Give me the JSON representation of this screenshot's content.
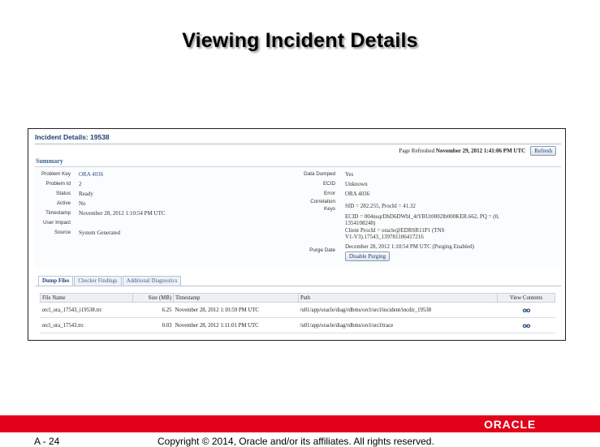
{
  "slide": {
    "title": "Viewing Incident Details",
    "page_number": "A - 24",
    "copyright": "Copyright © 2014, Oracle and/or its affiliates. All rights reserved.",
    "logo_text": "ORACLE"
  },
  "colors": {
    "accent_red": "#e2001a",
    "header_blue": "#1f3f73",
    "link_blue": "#2a4d8a"
  },
  "incident": {
    "header": "Incident Details: 19538",
    "page_refreshed_label": "Page Refreshed",
    "page_refreshed_value": "November 29, 2012 1:41:06 PM UTC",
    "refresh_button": "Refresh",
    "summary_title": "Summary",
    "left_fields": {
      "problem_key": {
        "label": "Problem Key",
        "value": "ORA 4036"
      },
      "problem_id": {
        "label": "Problem Id",
        "value": "2"
      },
      "status": {
        "label": "Status",
        "value": "Ready"
      },
      "active": {
        "label": "Active",
        "value": "No"
      },
      "timestamp": {
        "label": "Timestamp",
        "value": "November 28, 2012 1:10:54 PM UTC"
      },
      "user_impact": {
        "label": "User Impact",
        "value": ""
      },
      "source": {
        "label": "Source",
        "value": "System Generated"
      }
    },
    "right_fields": {
      "data_dumped": {
        "label": "Data Dumped",
        "value": "Yes"
      },
      "ecid": {
        "label": "ECID",
        "value": "Unknown"
      },
      "error": {
        "label": "Error",
        "value": "ORA 4036"
      },
      "correlation_keys": {
        "label_line1": "Correlation",
        "label_line2": "Keys",
        "line1": "SID = 282.255, ProcId = 41.32",
        "line2": "ECID = 004nsqrDhD6DWbl_4tYBUt0002lb000KER.662, PQ = (0,",
        "line3": "1354108248)",
        "line4": "Client ProcId = oracle@EDRSR11P1 (TNS",
        "line5": "V1-V3).17543_139781106417216"
      },
      "purge_date": {
        "label": "Purge Date",
        "value": "December 28, 2012 1:10:54 PM UTC (Purging Enabled)"
      },
      "disable_purging_button": "Disable Purging"
    },
    "tabs": [
      "Dump Files",
      "Checker Findings",
      "Additional Diagnostics"
    ],
    "table": {
      "columns": [
        "File Name",
        "Size (MB)",
        "Timestamp",
        "Path",
        "View Contents"
      ],
      "rows": [
        {
          "file_name": "orcl_ora_17543_i19538.trc",
          "size": "6.25",
          "timestamp": "November 28, 2012 1:10:59 PM UTC",
          "path": "/u01/app/oracle/diag/rdbms/orcl/orcl/incident/incdir_19538",
          "view_icon": "glasses-icon"
        },
        {
          "file_name": "orcl_ora_17543.trc",
          "size": "0.03",
          "timestamp": "November 28, 2012 1:11:01 PM UTC",
          "path": "/u01/app/oracle/diag/rdbms/orcl/orcl/trace",
          "view_icon": "glasses-icon"
        }
      ]
    }
  }
}
